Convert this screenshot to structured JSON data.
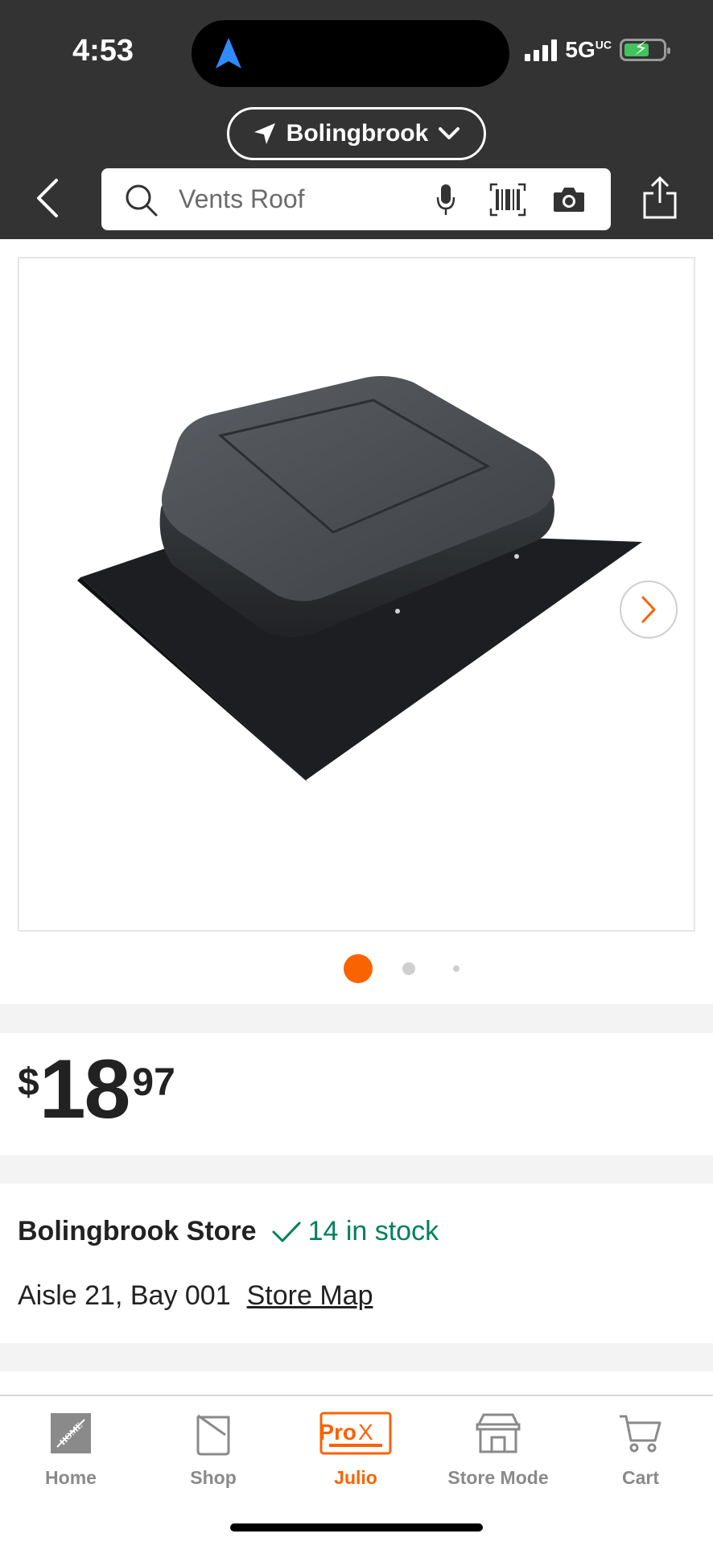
{
  "status_bar": {
    "time": "4:53",
    "network": "5G",
    "network_superscript": "UC",
    "battery_state": "charging"
  },
  "location": {
    "label": "Bolingbrook"
  },
  "search": {
    "placeholder": "Vents Roof"
  },
  "product": {
    "image_alt": "black square roof vent on flat flashing",
    "gallery": {
      "image_count": 3,
      "active_index": 0
    },
    "price": {
      "symbol": "$",
      "dollars": "18",
      "cents": "97"
    }
  },
  "store": {
    "name": "Bolingbrook Store",
    "stock": "14 in stock",
    "location": "Aisle 21, Bay 001",
    "map_link": "Store Map"
  },
  "tabs": [
    {
      "label": "Home",
      "icon": "home-depot-logo-icon",
      "active": false
    },
    {
      "label": "Shop",
      "icon": "paint-bucket-icon",
      "active": false
    },
    {
      "label": "Julio",
      "icon": "prox-badge-icon",
      "active": true,
      "badge_text_1": "Pro",
      "badge_text_2": "X"
    },
    {
      "label": "Store Mode",
      "icon": "store-icon",
      "active": false
    },
    {
      "label": "Cart",
      "icon": "cart-icon",
      "active": false
    }
  ],
  "colors": {
    "header_bg": "#333333",
    "accent_orange": "#f96302",
    "stock_green": "#00805a",
    "inactive_tab": "#8a8a8a"
  }
}
